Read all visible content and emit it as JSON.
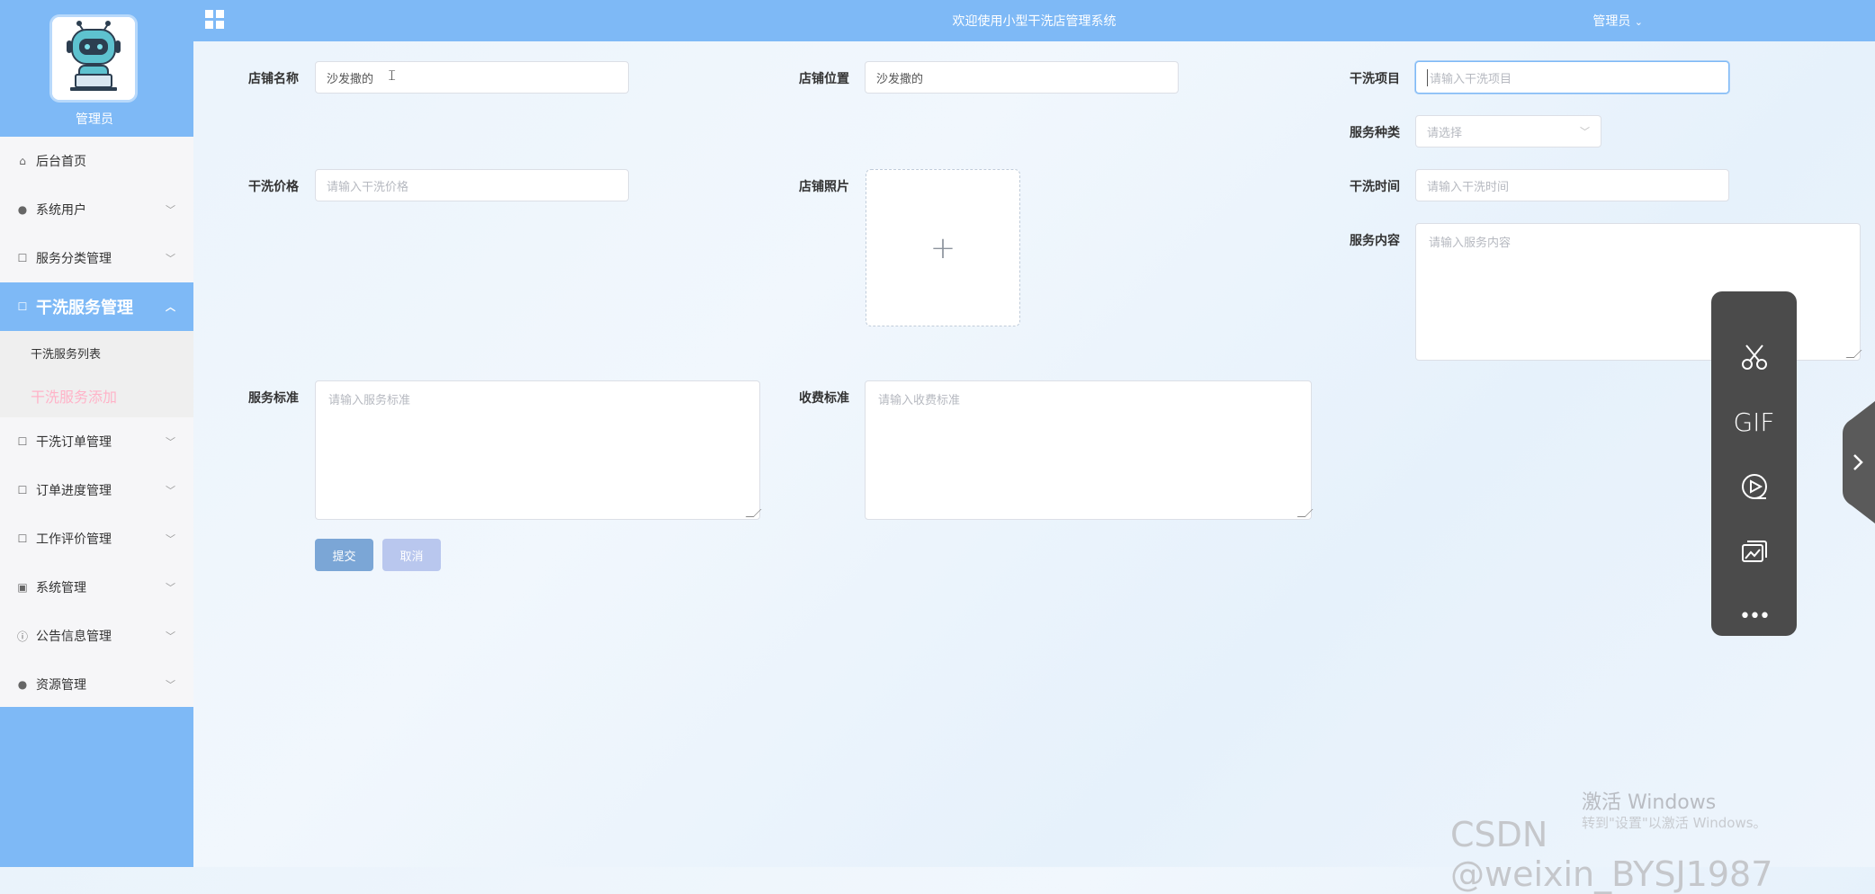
{
  "header": {
    "title": "欢迎使用小型干洗店管理系统",
    "user_menu": "管理员",
    "user_menu_arrow": "⌄"
  },
  "sidebar": {
    "admin_label": "管理员",
    "items": [
      {
        "label": "后台首页",
        "icon": "home-icon"
      },
      {
        "label": "系统用户",
        "icon": "user-icon"
      },
      {
        "label": "服务分类管理",
        "icon": "edit-icon"
      },
      {
        "label": "干洗服务管理",
        "icon": "edit-icon",
        "active": true
      },
      {
        "label": "干洗订单管理",
        "icon": "edit-icon"
      },
      {
        "label": "订单进度管理",
        "icon": "edit-icon"
      },
      {
        "label": "工作评价管理",
        "icon": "edit-icon"
      },
      {
        "label": "系统管理",
        "icon": "image-icon"
      },
      {
        "label": "公告信息管理",
        "icon": "info-icon"
      },
      {
        "label": "资源管理",
        "icon": "bulb-icon"
      }
    ],
    "subitems": [
      {
        "label": "干洗服务列表"
      },
      {
        "label": "干洗服务添加",
        "current": true
      }
    ]
  },
  "form": {
    "shop_name": {
      "label": "店铺名称",
      "value": "沙发撒的"
    },
    "shop_location": {
      "label": "店铺位置",
      "value": "沙发撒的"
    },
    "dry_item": {
      "label": "干洗项目",
      "placeholder": "请输入干洗项目"
    },
    "service_type": {
      "label": "服务种类",
      "placeholder": "请选择"
    },
    "dry_price": {
      "label": "干洗价格",
      "placeholder": "请输入干洗价格"
    },
    "shop_photo": {
      "label": "店铺照片",
      "plus": "+"
    },
    "dry_time": {
      "label": "干洗时间",
      "placeholder": "请输入干洗时间"
    },
    "service_content": {
      "label": "服务内容",
      "placeholder": "请输入服务内容"
    },
    "service_standard": {
      "label": "服务标准",
      "placeholder": "请输入服务标准"
    },
    "charge_standard": {
      "label": "收费标准",
      "placeholder": "请输入收费标准"
    },
    "submit_label": "提交",
    "cancel_label": "取消"
  },
  "float_toolbar": {
    "gif_label": "GIF",
    "more_label": "•••"
  },
  "watermarks": {
    "activate_title": "激活 Windows",
    "activate_sub": "转到\"设置\"以激活 Windows。",
    "csdn": "CSDN @weixin_BYSJ1987"
  },
  "colors": {
    "primary": "#7eb9f6",
    "submit_btn": "#7ba6d6",
    "cancel_btn": "#b9c7ee",
    "active_sub": "#ffb3c8",
    "toolbar_bg": "#4b4b4b"
  }
}
